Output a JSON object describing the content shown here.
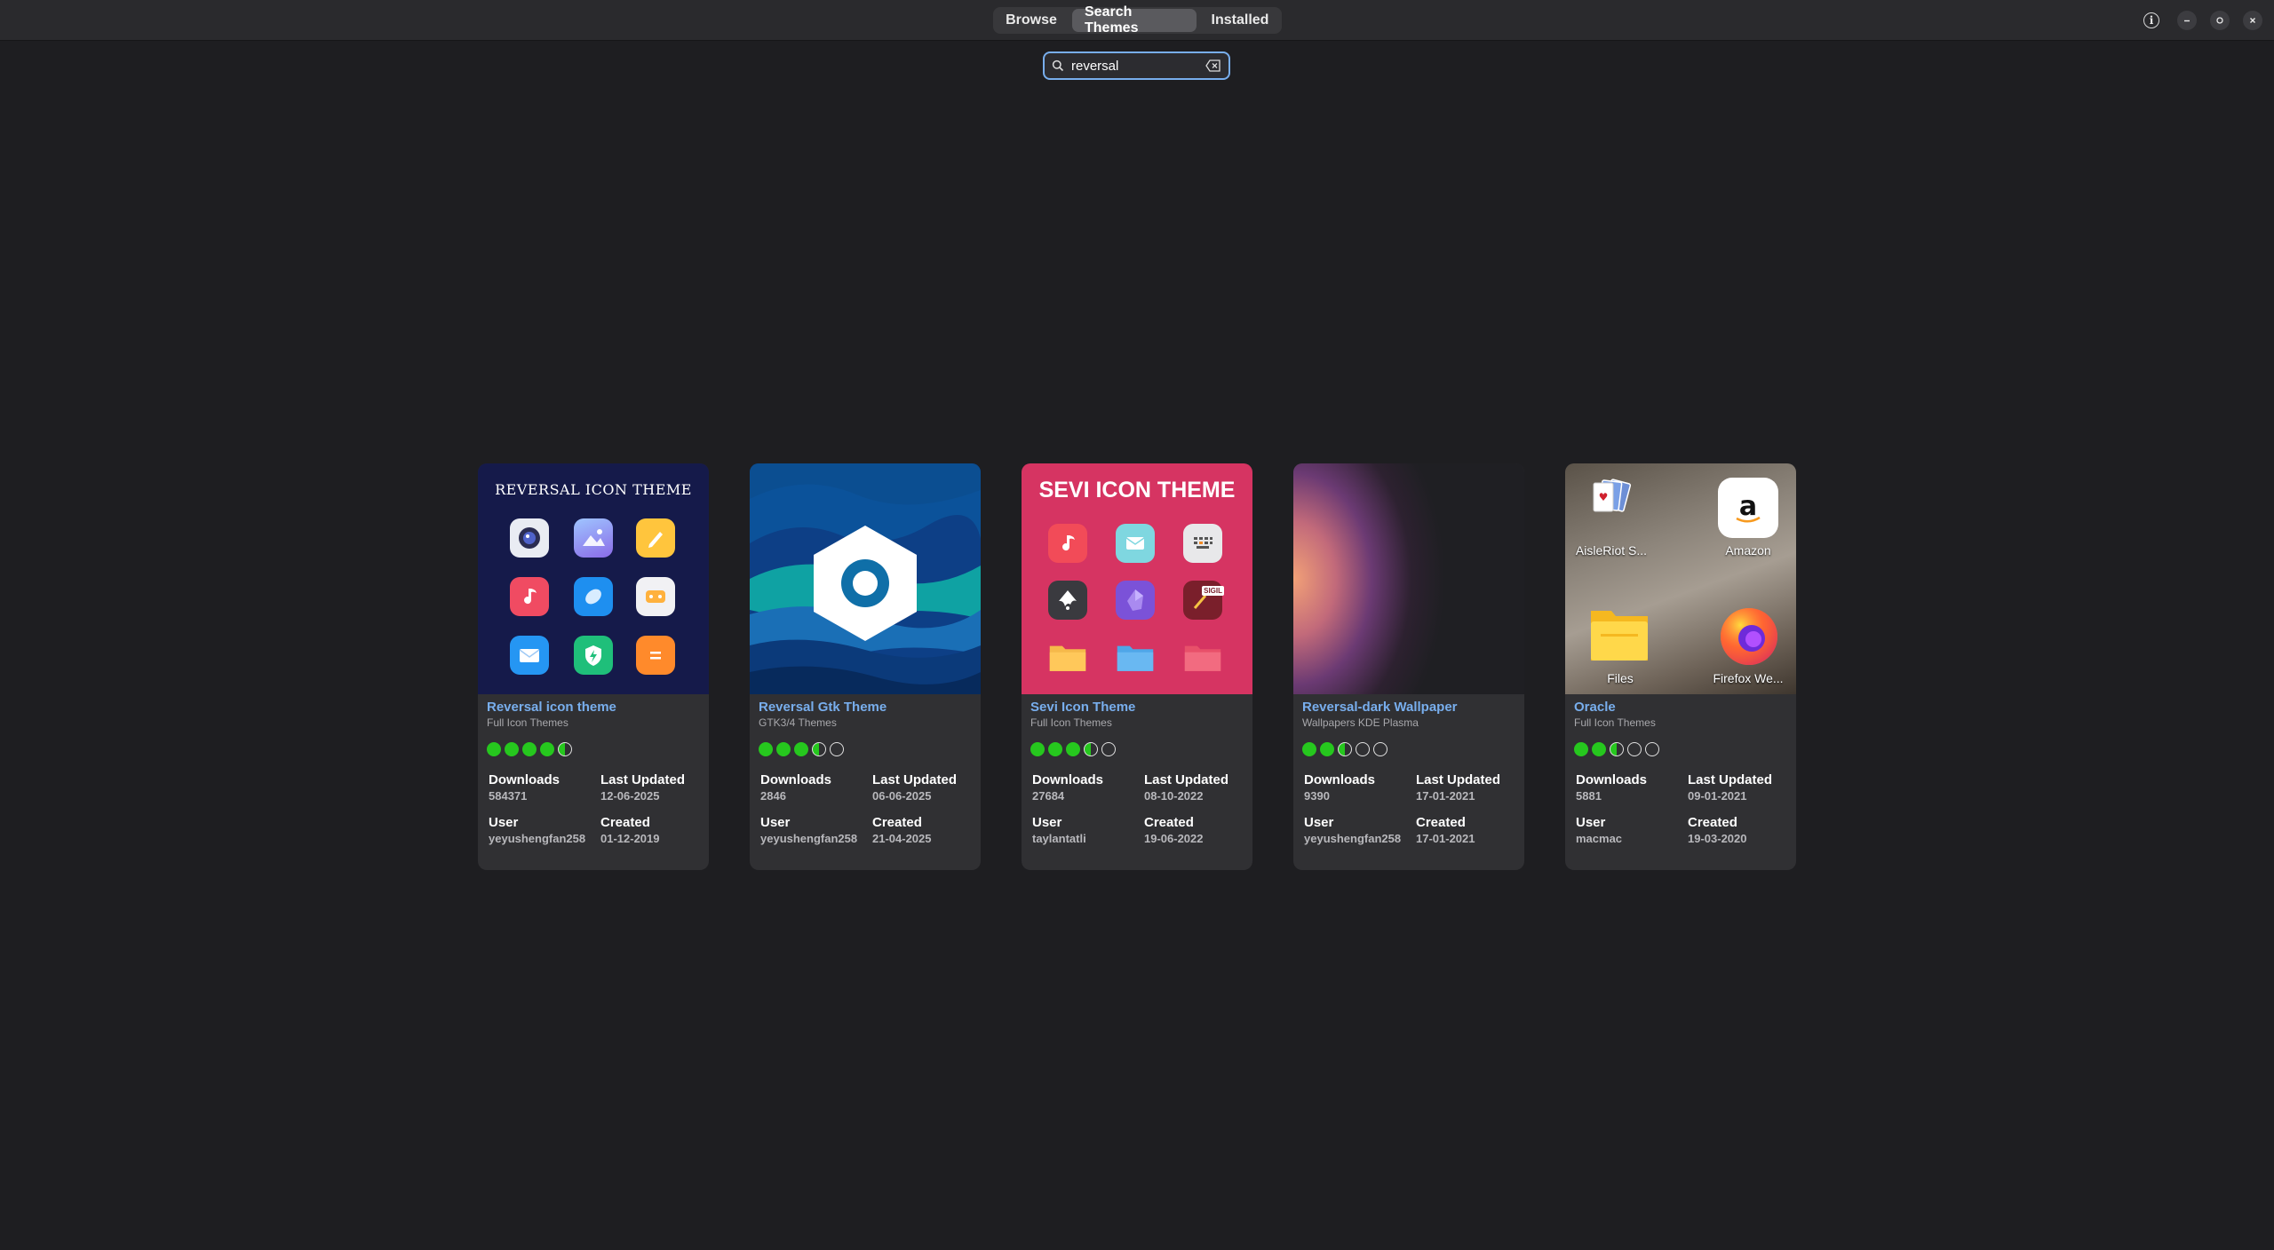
{
  "header": {
    "tabs": [
      {
        "label": "Browse",
        "active": false
      },
      {
        "label": "Search Themes",
        "active": true
      },
      {
        "label": "Installed",
        "active": false
      }
    ],
    "info_glyph": "i",
    "window_controls": [
      "minimize-icon",
      "restore-icon",
      "close-icon"
    ]
  },
  "search": {
    "value": "reversal",
    "icon": "search-icon",
    "clear_icon": "clear-text-icon",
    "accent": "#78aeed"
  },
  "labels": {
    "downloads": "Downloads",
    "last_updated": "Last Updated",
    "user": "User",
    "created": "Created"
  },
  "cards": [
    {
      "title": "Reversal icon theme",
      "category": "Full Icon Themes",
      "rating": 4.5,
      "downloads": "584371",
      "last_updated": "12-06-2025",
      "user": "yeyushengfan258",
      "created": "01-12-2019",
      "thumb_heading": "REVERSAL ICON THEME"
    },
    {
      "title": "Reversal Gtk Theme",
      "category": "GTK3/4 Themes",
      "rating": 3.5,
      "downloads": "2846",
      "last_updated": "06-06-2025",
      "user": "yeyushengfan258",
      "created": "21-04-2025"
    },
    {
      "title": "Sevi Icon Theme",
      "category": "Full Icon Themes",
      "rating": 3.5,
      "downloads": "27684",
      "last_updated": "08-10-2022",
      "user": "taylantatli",
      "created": "19-06-2022",
      "thumb_heading": "SEVI ICON THEME",
      "thumb_badge": "SIGIL"
    },
    {
      "title": "Reversal-dark Wallpaper",
      "category": "Wallpapers KDE Plasma",
      "rating": 2.5,
      "downloads": "9390",
      "last_updated": "17-01-2021",
      "user": "yeyushengfan258",
      "created": "17-01-2021"
    },
    {
      "title": "Oracle",
      "category": "Full Icon Themes",
      "rating": 2.5,
      "downloads": "5881",
      "last_updated": "09-01-2021",
      "user": "macmac",
      "created": "19-03-2020",
      "thumb_apps": [
        "AisleRiot S...",
        "Amazon",
        "Files",
        "Firefox We..."
      ]
    }
  ],
  "colors": {
    "background": "#1e1e21",
    "card": "#303033",
    "title": "#78aeed",
    "rating_fill": "#26c71e"
  }
}
